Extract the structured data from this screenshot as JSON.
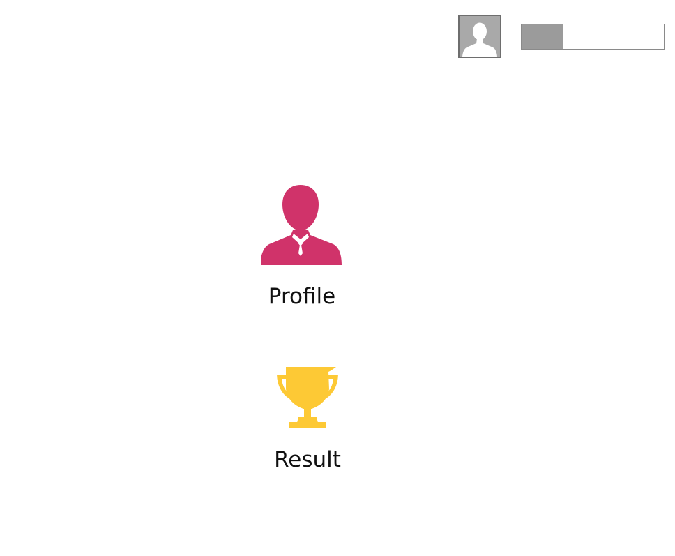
{
  "header": {
    "avatar_icon": "user-silhouette-icon",
    "progress": {
      "fraction": 0.29,
      "fill_color": "#9b9b9b",
      "track_color": "#ffffff"
    }
  },
  "menu": {
    "items": [
      {
        "label": "Profile",
        "icon": "businessman-icon",
        "color": "#d0336a"
      },
      {
        "label": "Result",
        "icon": "trophy-icon",
        "color": "#fdc935"
      }
    ]
  }
}
